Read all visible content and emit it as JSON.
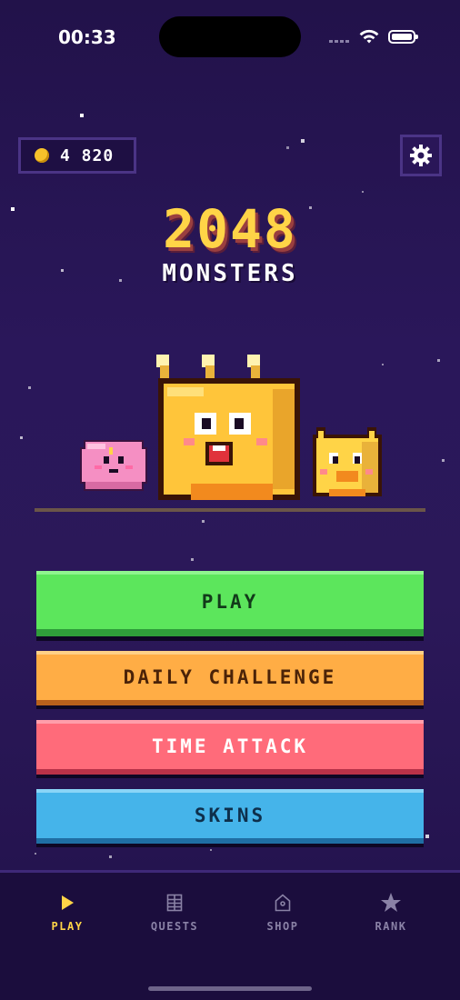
{
  "status_bar": {
    "time": "00:33"
  },
  "header": {
    "coins": "4 820"
  },
  "title": {
    "main": "2048",
    "sub": "MONSTERS"
  },
  "menu": {
    "play": "PLAY",
    "daily_challenge": "DAILY CHALLENGE",
    "time_attack": "TIME ATTACK",
    "skins": "SKINS"
  },
  "tabs": [
    {
      "label": "PLAY",
      "icon": "play-icon",
      "active": true
    },
    {
      "label": "QUESTS",
      "icon": "quests-icon",
      "active": false
    },
    {
      "label": "SHOP",
      "icon": "shop-icon",
      "active": false
    },
    {
      "label": "RANK",
      "icon": "star-icon",
      "active": false
    }
  ],
  "colors": {
    "background": "#2a175a",
    "accent": "#ffd447",
    "play": "#5ce65c",
    "daily": "#ffad45",
    "time_attack": "#ff6b7a",
    "skins": "#45b4ea"
  }
}
